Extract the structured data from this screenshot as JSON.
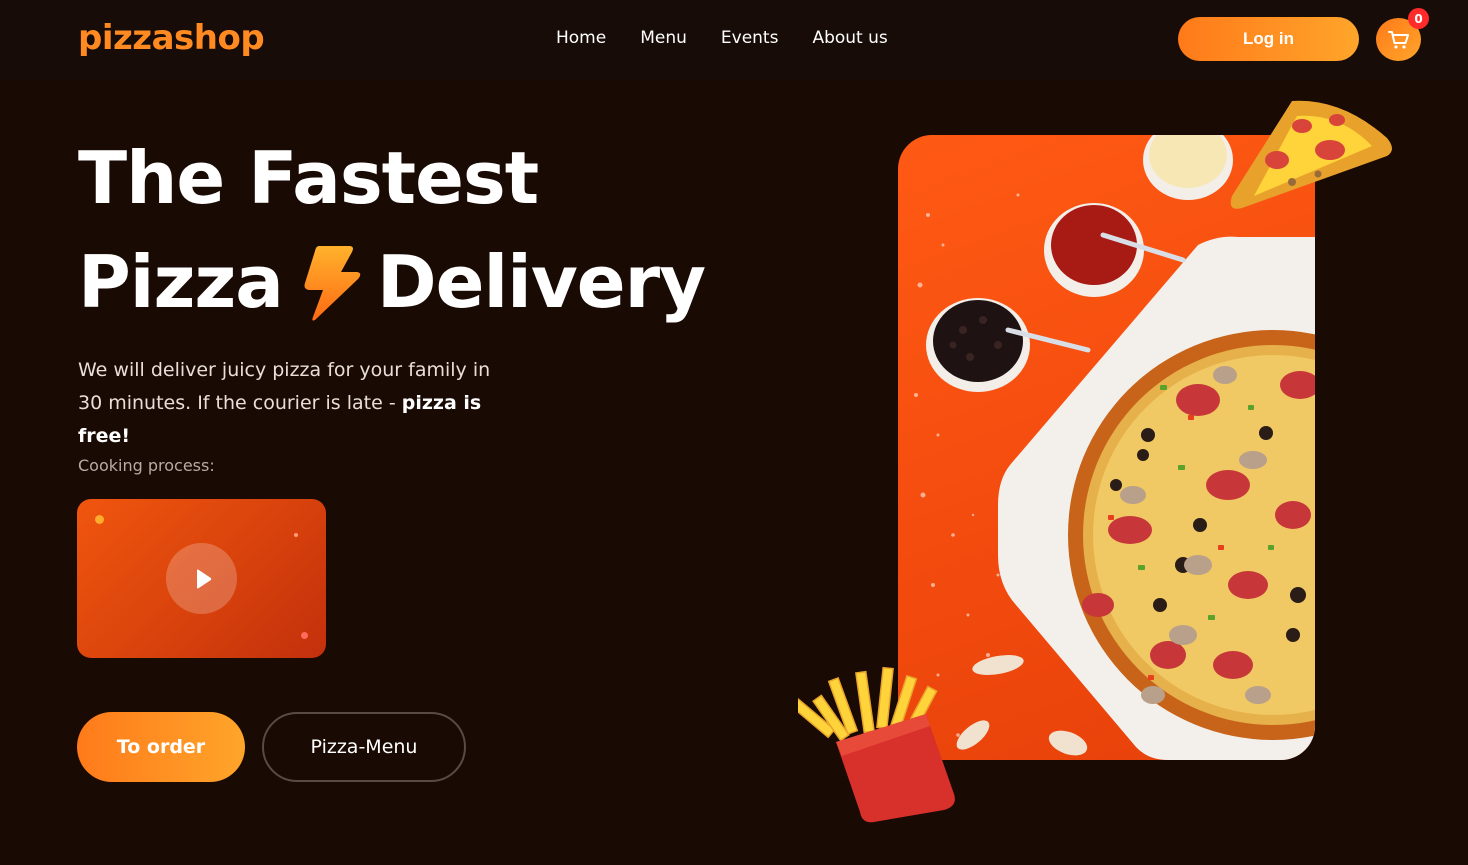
{
  "header": {
    "logo": "pizzashop",
    "nav": [
      {
        "label": "Home"
      },
      {
        "label": "Menu"
      },
      {
        "label": "Events"
      },
      {
        "label": "About us"
      }
    ],
    "login_label": "Log in",
    "cart_count": "0"
  },
  "hero": {
    "title_line1": "The Fastest",
    "title_word_pizza": "Pizza",
    "title_word_delivery": "Delivery",
    "desc_text": "We will deliver juicy pizza for your family in 30 minutes. If the courier is late - ",
    "desc_bold": "pizza is free!",
    "cooking_label": "Cooking process:",
    "order_button": "To order",
    "menu_button": "Pizza-Menu"
  },
  "colors": {
    "accent": "#ff8a22",
    "background": "#1a0a04",
    "badge": "#ff2a2a"
  },
  "icons": [
    "cart-icon",
    "bolt-icon",
    "play-icon"
  ]
}
